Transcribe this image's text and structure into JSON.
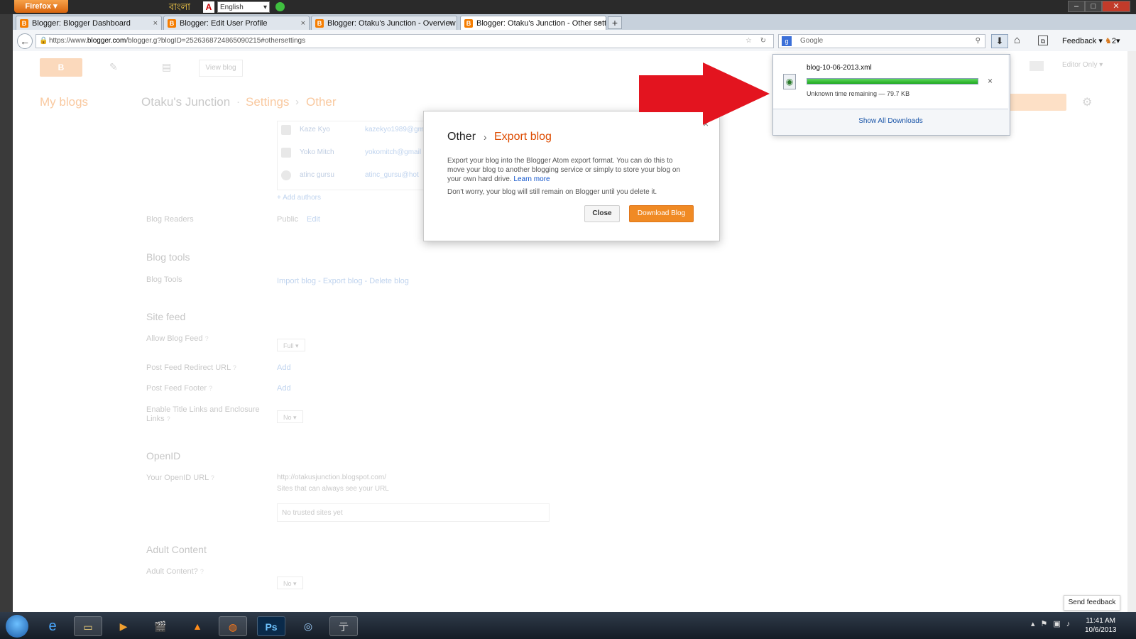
{
  "browser": {
    "menu_label": "Firefox",
    "bengali_text": "বাংলা",
    "language": "English",
    "tabs": [
      {
        "label": "Blogger: Blogger Dashboard"
      },
      {
        "label": "Blogger: Edit User Profile"
      },
      {
        "label": "Blogger: Otaku's Junction - Overview"
      },
      {
        "label": "Blogger: Otaku's Junction - Other sett..."
      }
    ],
    "url_prefix": "https://www.",
    "url_domain": "blogger.com",
    "url_path": "/blogger.g?blogID=2526368724865090215#othersettings",
    "search_placeholder": "Google",
    "feedback_label": "Feedback",
    "badge_count": "2"
  },
  "blogger_top": {
    "view_blog": "View blog",
    "editor_only": "Editor Only",
    "my_blogs": "My blogs",
    "blog_name": "Otaku's Junction",
    "crumb_settings": "Settings",
    "crumb_other": "Other"
  },
  "authors": [
    {
      "name": "Kaze Kyo",
      "email": "kazekyo1989@gm"
    },
    {
      "name": "Yoko Mitch",
      "email": "yokomitch@gmail"
    },
    {
      "name": "atinc gursu",
      "email": "atinc_gursu@hot"
    }
  ],
  "settings": {
    "add_authors": "+ Add authors",
    "blog_readers_label": "Blog Readers",
    "blog_readers_value": "Public",
    "blog_readers_edit": "Edit",
    "blog_tools_heading": "Blog tools",
    "blog_tools_label": "Blog Tools",
    "import_blog": "Import blog",
    "export_blog": "Export blog",
    "delete_blog": "Delete blog",
    "tools_sep": " - ",
    "site_feed_heading": "Site feed",
    "allow_feed_label": "Allow Blog Feed",
    "allow_feed_value": "Full",
    "redirect_label": "Post Feed Redirect URL",
    "redirect_value": "Add",
    "footer_label": "Post Feed Footer",
    "footer_value": "Add",
    "title_links_label_1": "Enable Title Links and Enclosure",
    "title_links_label_2": "Links",
    "title_links_value": "No",
    "openid_heading": "OpenID",
    "openid_label": "Your OpenID URL",
    "openid_url": "http://otakusjunction.blogspot.com/",
    "openid_sites_note": "Sites that can always see your URL",
    "openid_sites_empty": "No trusted sites yet",
    "adult_heading": "Adult Content",
    "adult_label": "Adult Content?",
    "adult_value": "No"
  },
  "modal": {
    "title_part1": "Other",
    "title_sep": "›",
    "title_part2": "Export blog",
    "body": "Export your blog into the Blogger Atom export format. You can do this to move your blog to another blogging service or simply to store your blog on your own hard drive.",
    "learn_more": "Learn more",
    "note": "Don't worry, your blog will still remain on Blogger until you delete it.",
    "close_label": "Close",
    "download_label": "Download Blog",
    "close_x": "×"
  },
  "downloads": {
    "filename": "blog-10-06-2013.xml",
    "progress": 1.0,
    "status": "Unknown time remaining — 79.7 KB",
    "show_all": "Show All Downloads",
    "cancel_x": "×"
  },
  "page_footer": {
    "send_feedback": "Send feedback"
  },
  "taskbar": {
    "time": "11:41 AM",
    "date": "10/6/2013",
    "ps_label": "Ps"
  },
  "colors": {
    "accent_orange": "#f08a24",
    "arrow_red": "#e3141f",
    "progress_green": "#1ea91e"
  }
}
